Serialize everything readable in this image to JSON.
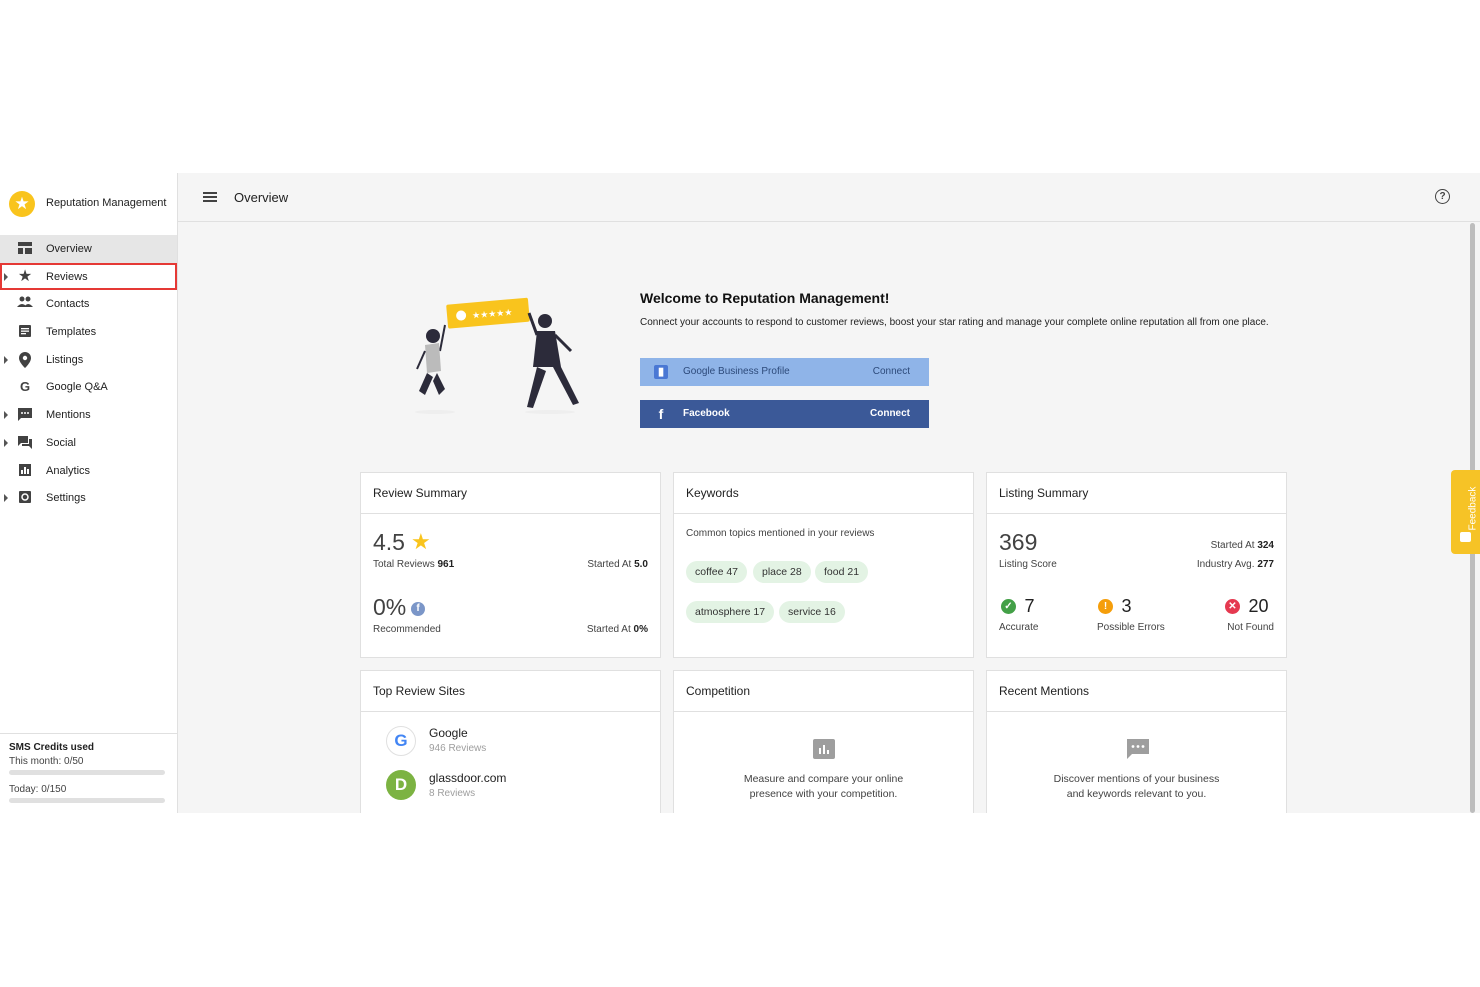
{
  "app": {
    "name": "Reputation Management"
  },
  "sidebar": {
    "items": [
      {
        "label": "Overview",
        "icon": "dashboard-icon",
        "expandable": false
      },
      {
        "label": "Reviews",
        "icon": "star-icon",
        "expandable": true
      },
      {
        "label": "Contacts",
        "icon": "people-icon",
        "expandable": false
      },
      {
        "label": "Templates",
        "icon": "document-icon",
        "expandable": false
      },
      {
        "label": "Listings",
        "icon": "location-pin-icon",
        "expandable": true
      },
      {
        "label": "Google Q&A",
        "icon": "google-g-icon",
        "expandable": false
      },
      {
        "label": "Mentions",
        "icon": "comment-icon",
        "expandable": true
      },
      {
        "label": "Social",
        "icon": "forum-icon",
        "expandable": true
      },
      {
        "label": "Analytics",
        "icon": "bar-chart-icon",
        "expandable": false
      },
      {
        "label": "Settings",
        "icon": "settings-icon",
        "expandable": true
      }
    ],
    "sms": {
      "title": "SMS Credits used",
      "month_label": "This month: 0/50",
      "month_used": 0,
      "month_total": 50,
      "today_label": "Today: 0/150",
      "today_used": 0,
      "today_total": 150
    }
  },
  "header": {
    "title": "Overview"
  },
  "welcome": {
    "title": "Welcome to Reputation Management!",
    "description": "Connect your accounts to respond to customer reviews, boost your star rating and manage your complete online reputation all from one place.",
    "google_button": {
      "label": "Google Business Profile",
      "action": "Connect"
    },
    "facebook_button": {
      "label": "Facebook",
      "action": "Connect"
    }
  },
  "review_summary": {
    "title": "Review Summary",
    "rating": "4.5",
    "total_label": "Total Reviews",
    "total_value": "961",
    "started_label": "Started At",
    "started_value": "5.0",
    "recommended_value": "0%",
    "recommended_label": "Recommended",
    "rec_started_label": "Started At",
    "rec_started_value": "0%"
  },
  "keywords": {
    "title": "Keywords",
    "subtitle": "Common topics mentioned in your reviews",
    "chips": [
      "coffee 47",
      "place 28",
      "food 21",
      "atmosphere 17",
      "service 16"
    ]
  },
  "listing_summary": {
    "title": "Listing Summary",
    "score": "369",
    "score_label": "Listing Score",
    "started_label": "Started At",
    "started_value": "324",
    "industry_label": "Industry Avg.",
    "industry_value": "277",
    "accurate_value": "7",
    "accurate_label": "Accurate",
    "errors_value": "3",
    "errors_label": "Possible Errors",
    "notfound_value": "20",
    "notfound_label": "Not Found"
  },
  "top_sites": {
    "title": "Top Review Sites",
    "sites": [
      {
        "name": "Google",
        "reviews": "946 Reviews"
      },
      {
        "name": "glassdoor.com",
        "reviews": "8 Reviews"
      }
    ]
  },
  "competition": {
    "title": "Competition",
    "text_line1": "Measure and compare your online",
    "text_line2": "presence with your competition."
  },
  "recent_mentions": {
    "title": "Recent Mentions",
    "text_line1": "Discover mentions of your business",
    "text_line2": "and keywords relevant to you."
  },
  "feedback": {
    "label": "Feedback"
  },
  "colors": {
    "accent": "#f9c41d",
    "facebook": "#3b5998",
    "google_button": "#8fb4e8",
    "chip": "#e3f3e4",
    "highlight": "#e53935"
  }
}
